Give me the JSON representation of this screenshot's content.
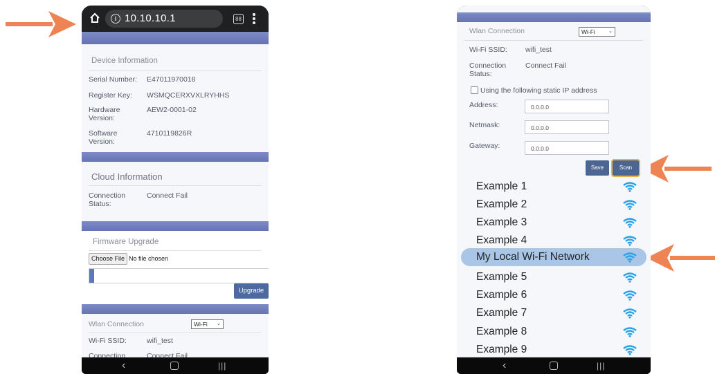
{
  "colors": {
    "arrow": "#ee8453",
    "band": "#7582bf",
    "panel": "#f5f7fb",
    "button": "#4d6691",
    "wifi": "#2aa2e8",
    "selected_row": "#a9c6e6"
  },
  "left_phone": {
    "browser": {
      "home_icon": "home-icon",
      "info_icon": "info-icon",
      "info_glyph": "i",
      "url": "10.10.10.1",
      "tabs_count": "88"
    },
    "device_information": {
      "title": "Device Information",
      "rows": [
        {
          "label": "Serial Number:",
          "value": "E47011970018"
        },
        {
          "label": "Register Key:",
          "value": "WSMQCERXVXLRYHHS"
        },
        {
          "label": "Hardware Version:",
          "value": "AEW2-0001-02"
        },
        {
          "label": "Software Version:",
          "value": "4710119826R"
        }
      ]
    },
    "cloud_information": {
      "title": "Cloud Information",
      "connection_label": "Connection Status:",
      "connection_value": "Connect Fail"
    },
    "firmware_upgrade": {
      "title": "Firmware Upgrade",
      "choose_file_label": "Choose File",
      "no_file_text": "No file chosen",
      "progress": 0.03,
      "upgrade_label": "Upgrade"
    },
    "wlan": {
      "title": "Wlan Connection",
      "mode": "Wi-Fi",
      "ssid_label": "Wi-Fi SSID:",
      "ssid_value": "wifi_test",
      "connection_label": "Connection",
      "connection_value": "Connect Fail"
    },
    "nav": {
      "back": "‹",
      "recent": "|||"
    }
  },
  "right_phone": {
    "wlan": {
      "title": "Wlan Connection",
      "mode": "Wi-Fi",
      "ssid_label": "Wi-Fi SSID:",
      "ssid_value": "wifi_test",
      "connection_label": "Connection Status:",
      "connection_value": "Connect Fail",
      "static_ip_label": "Using the following static IP address",
      "static_ip_checked": false,
      "address_label": "Address:",
      "address_value": "0.0.0.0",
      "netmask_label": "Netmask:",
      "netmask_value": "0.0.0.0",
      "gateway_label": "Gateway:",
      "gateway_value": "0.0.0.0",
      "save_label": "Save",
      "scan_label": "Scan"
    },
    "networks": [
      {
        "name": "Example 1",
        "selected": false
      },
      {
        "name": "Example 2",
        "selected": false
      },
      {
        "name": "Example 3",
        "selected": false
      },
      {
        "name": "Example 4",
        "selected": false
      },
      {
        "name": "My Local Wi-Fi Network",
        "selected": true
      },
      {
        "name": "Example 5",
        "selected": false
      },
      {
        "name": "Example 6",
        "selected": false
      },
      {
        "name": "Example 7",
        "selected": false
      },
      {
        "name": "Example 8",
        "selected": false
      },
      {
        "name": "Example 9",
        "selected": false
      }
    ],
    "nav": {
      "back": "‹",
      "recent": "|||"
    }
  }
}
